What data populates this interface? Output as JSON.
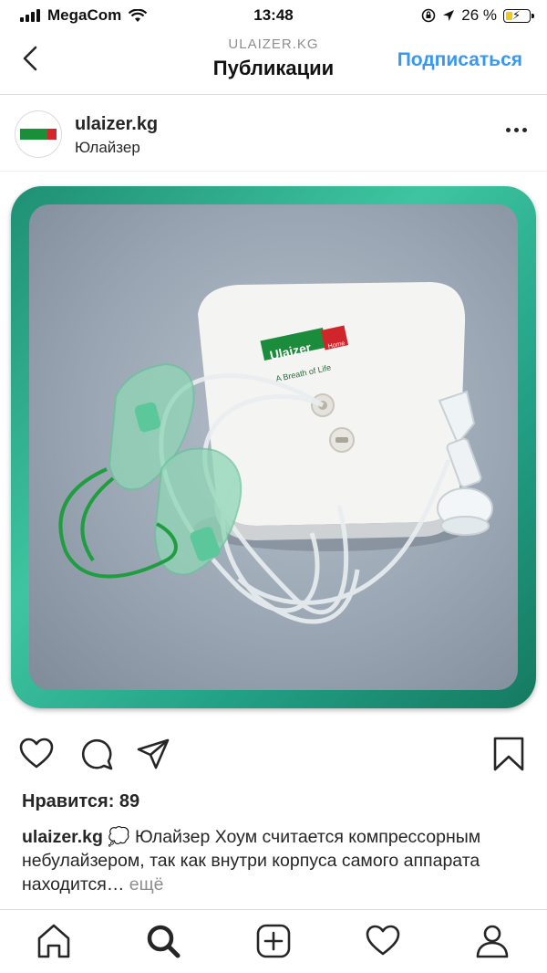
{
  "status_bar": {
    "carrier": "MegaCom",
    "time": "13:48",
    "battery": "26 %"
  },
  "header": {
    "subtitle": "ULAIZER.KG",
    "title": "Публикации",
    "follow_label": "Подписаться"
  },
  "post": {
    "username": "ulaizer.kg",
    "location": "Юлайзер",
    "image": {
      "device_brand": "Ulaizer",
      "device_badge": "Home",
      "device_tagline": "A Breath of Life"
    },
    "likes_text": "Нравится: 89",
    "caption_user": "ulaizer.kg",
    "caption_text": " 💭 Юлайзер Хоум считается компрессорным небулайзером, так как внутри корпуса самого аппарата находится…",
    "more_label": " ещё"
  },
  "icons": {
    "back": "back-chevron-icon",
    "more": "more-options-icon",
    "like": "heart-icon",
    "comment": "comment-icon",
    "share": "send-icon",
    "save": "bookmark-icon",
    "home": "home-icon",
    "search": "search-icon",
    "new_post": "add-post-icon",
    "activity": "heart-icon",
    "profile": "profile-icon"
  },
  "colors": {
    "link_blue": "#3897f0",
    "frame_green": "#2fb08f",
    "battery_yellow": "#f2c81b"
  }
}
